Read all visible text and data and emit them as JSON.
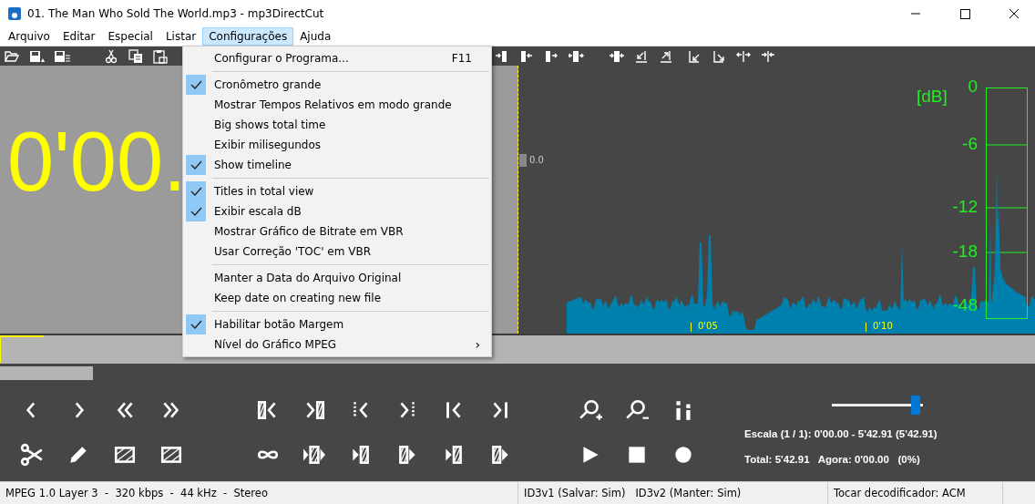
{
  "window": {
    "title": "01. The Man Who Sold The World.mp3 - mp3DirectCut"
  },
  "menubar": [
    {
      "label": "Arquivo",
      "selected": false
    },
    {
      "label": "Editar",
      "selected": false
    },
    {
      "label": "Especial",
      "selected": false
    },
    {
      "label": "Listar",
      "selected": false
    },
    {
      "label": "Configurações",
      "selected": true
    },
    {
      "label": "Ajuda",
      "selected": false
    }
  ],
  "big_time": "0'00.",
  "waveform": {
    "marker_value": "0.0",
    "time_labels": [
      "0'05",
      "0'10"
    ]
  },
  "db_meter": {
    "unit": "[dB]",
    "scale": [
      "0",
      "-6",
      "-12",
      "-18",
      "-48"
    ]
  },
  "zoom_slider": {
    "level": 0.97
  },
  "progress": {
    "level": 0.09
  },
  "scale_info": "Escala (1 / 1): 0'00.00 - 5'42.91 (5'42.91)",
  "position_info": "Total: 5'42.91   Agora: 0'00.00   (0%)",
  "status_bar": [
    "MPEG 1.0 Layer 3  -  320 kbps  -  44 kHz  -  Stereo",
    "ID3v1 (Salvar: Sim)   ID3v2 (Manter: Sim)",
    "Tocar decodificador: ACM"
  ],
  "menu": {
    "items": [
      {
        "kind": "item",
        "label": "Configurar o Programa...",
        "checked": false,
        "shortcut": "F11"
      },
      {
        "kind": "separator"
      },
      {
        "kind": "item",
        "label": "Cronômetro grande",
        "checked": true
      },
      {
        "kind": "item",
        "label": "Mostrar Tempos Relativos em modo grande",
        "checked": false
      },
      {
        "kind": "item",
        "label": "Big shows total time",
        "checked": false
      },
      {
        "kind": "item",
        "label": "Exibir milisegundos",
        "checked": false
      },
      {
        "kind": "item",
        "label": "Show timeline",
        "checked": true
      },
      {
        "kind": "separator"
      },
      {
        "kind": "item",
        "label": "Titles in total view",
        "checked": true
      },
      {
        "kind": "item",
        "label": "Exibir escala dB",
        "checked": true
      },
      {
        "kind": "item",
        "label": "Mostrar Gráfico de Bitrate em VBR",
        "checked": false
      },
      {
        "kind": "item",
        "label": "Usar Correção 'TOC' em VBR",
        "checked": false
      },
      {
        "kind": "separator"
      },
      {
        "kind": "item",
        "label": "Manter a Data do Arquivo Original",
        "checked": false
      },
      {
        "kind": "item",
        "label": "Keep date on creating new file",
        "checked": false
      },
      {
        "kind": "separator"
      },
      {
        "kind": "item",
        "label": "Habilitar botão Margem",
        "checked": true
      },
      {
        "kind": "item",
        "label": "Nível do Gráfico MPEG",
        "checked": false,
        "arrow": "›"
      }
    ]
  }
}
